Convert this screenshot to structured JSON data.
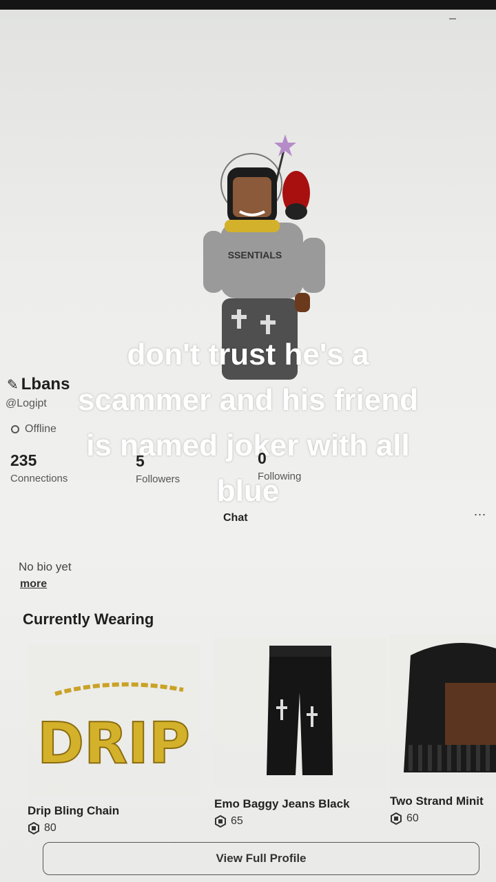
{
  "overlay_caption": "don't trust he's a scammer and his friend is named joker with all blue",
  "profile": {
    "display_name": "Lbans",
    "username": "@Logipt",
    "status": "Offline",
    "stats": {
      "connections": {
        "value": "235",
        "label": "Connections"
      },
      "followers": {
        "value": "5",
        "label": "Followers"
      },
      "following": {
        "value": "0",
        "label": "Following"
      }
    },
    "chat_label": "Chat",
    "more_menu": "...",
    "bio": "No bio yet",
    "bio_more": "more"
  },
  "wearing": {
    "title": "Currently Wearing",
    "items": [
      {
        "name": "Drip Bling Chain",
        "price": "80"
      },
      {
        "name": "Emo Baggy Jeans Black",
        "price": "65"
      },
      {
        "name": "Two Strand Minit",
        "price": "60"
      }
    ]
  },
  "view_full_profile": "View Full Profile",
  "colors": {
    "background": "#eeeeec",
    "caption": "#ffffff",
    "accent_gold": "#d4b12a"
  }
}
